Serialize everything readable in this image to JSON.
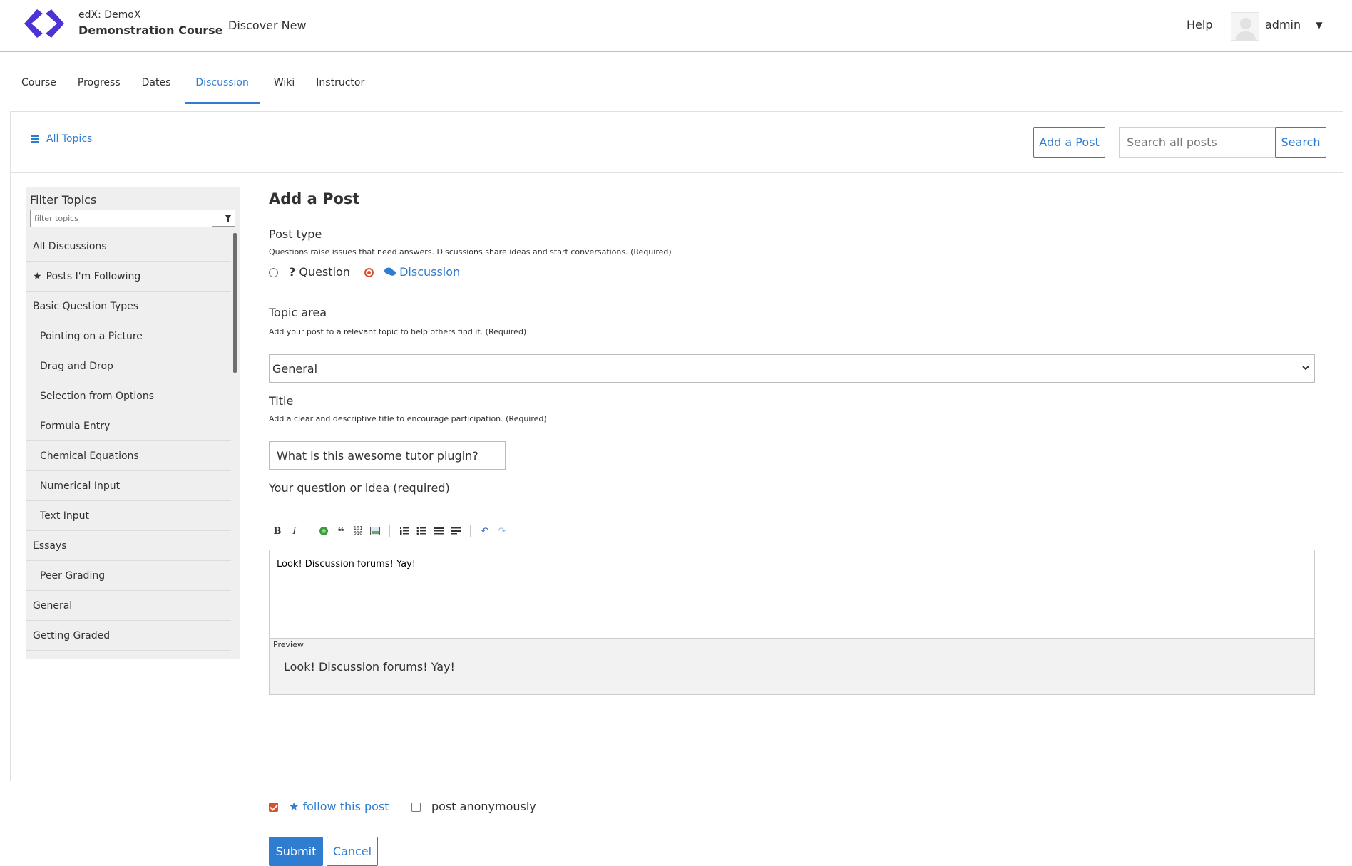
{
  "header": {
    "course_org": "edX: DemoX",
    "course_name": "Demonstration Course",
    "discover": "Discover New",
    "help": "Help",
    "username": "admin"
  },
  "tabs": [
    {
      "label": "Course",
      "active": false
    },
    {
      "label": "Progress",
      "active": false
    },
    {
      "label": "Dates",
      "active": false
    },
    {
      "label": "Discussion",
      "active": true
    },
    {
      "label": "Wiki",
      "active": false
    },
    {
      "label": "Instructor",
      "active": false
    }
  ],
  "toolbar": {
    "all_topics": "All Topics",
    "add_post": "Add a Post",
    "search_placeholder": "Search all posts",
    "search_button": "Search"
  },
  "sidebar": {
    "filter_title": "Filter Topics",
    "filter_placeholder": "filter topics",
    "topics": [
      {
        "label": "All Discussions",
        "sub": false
      },
      {
        "label": "Posts I'm Following",
        "sub": false
      },
      {
        "label": "Basic Question Types",
        "sub": false
      },
      {
        "label": "Pointing on a Picture",
        "sub": true
      },
      {
        "label": "Drag and Drop",
        "sub": true
      },
      {
        "label": "Selection from Options",
        "sub": true
      },
      {
        "label": "Formula Entry",
        "sub": true
      },
      {
        "label": "Chemical Equations",
        "sub": true
      },
      {
        "label": "Numerical Input",
        "sub": true
      },
      {
        "label": "Text Input",
        "sub": true
      },
      {
        "label": "Essays",
        "sub": false
      },
      {
        "label": "Peer Grading",
        "sub": true
      },
      {
        "label": "General",
        "sub": false
      },
      {
        "label": "Getting Graded",
        "sub": false
      }
    ]
  },
  "form": {
    "title": "Add a Post",
    "post_type_label": "Post type",
    "post_type_help": "Questions raise issues that need answers. Discussions share ideas and start conversations. (Required)",
    "question_label": "Question",
    "discussion_label": "Discussion",
    "topic_label": "Topic area",
    "topic_help": "Add your post to a relevant topic to help others find it. (Required)",
    "topic_value": "General",
    "title_label": "Title",
    "title_help": "Add a clear and descriptive title to encourage participation. (Required)",
    "title_value": "What is this awesome tutor plugin?",
    "body_label": "Your question or idea (required)",
    "body_value": "Look! Discussion forums! Yay!",
    "preview_label": "Preview",
    "preview_value": "Look! Discussion forums! Yay!",
    "follow_label": "follow this post",
    "anon_label": "post anonymously",
    "submit": "Submit",
    "cancel": "Cancel"
  },
  "colors": {
    "accent": "#2f7dd1",
    "checked": "#d9502f",
    "logo": "#4d33d4"
  }
}
